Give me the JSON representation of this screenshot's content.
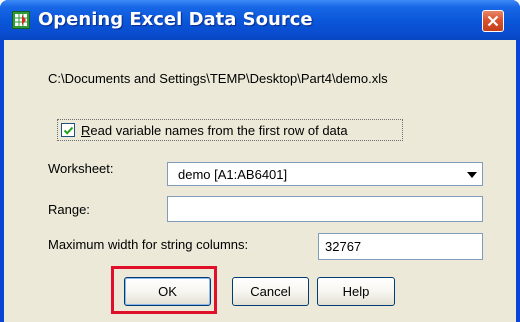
{
  "window": {
    "title": "Opening Excel Data Source"
  },
  "file_path": "C:\\Documents and Settings\\TEMP\\Desktop\\Part4\\demo.xls",
  "checkbox": {
    "label_accel": "R",
    "label_rest": "ead variable names from the first row of data",
    "checked": true
  },
  "worksheet": {
    "label": "Worksheet:",
    "value": "demo [A1:AB6401]"
  },
  "range": {
    "label": "Range:",
    "value": ""
  },
  "max_width": {
    "label": "Maximum width for string columns:",
    "value": "32767"
  },
  "buttons": {
    "ok": "OK",
    "cancel": "Cancel",
    "help": "Help"
  },
  "colors": {
    "titlebar": "#0a55d8",
    "dialog_bg": "#ece9d8",
    "highlight": "#e0102a"
  }
}
